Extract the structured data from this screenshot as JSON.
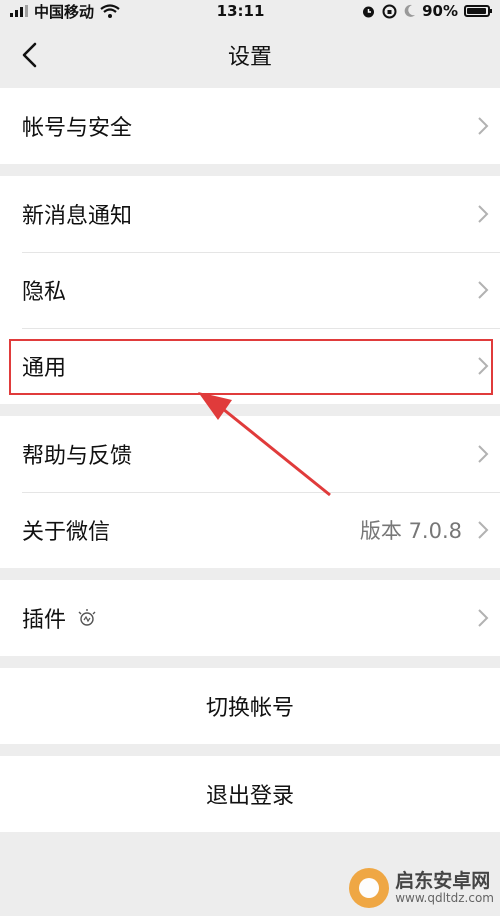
{
  "status_bar": {
    "carrier": "中国移动",
    "time": "13:11",
    "battery": "90%",
    "icons": [
      "signal-icon",
      "wifi-icon",
      "alarm-icon",
      "lock-rotation-icon",
      "moon-icon",
      "battery-icon"
    ]
  },
  "nav": {
    "title": "设置"
  },
  "groups": [
    {
      "items": [
        {
          "label": "帐号与安全"
        }
      ]
    },
    {
      "items": [
        {
          "label": "新消息通知"
        },
        {
          "label": "隐私"
        },
        {
          "label": "通用"
        }
      ]
    },
    {
      "items": [
        {
          "label": "帮助与反馈"
        },
        {
          "label": "关于微信",
          "value": "版本 7.0.8"
        }
      ]
    },
    {
      "items": [
        {
          "label": "插件"
        }
      ]
    }
  ],
  "actions": {
    "switch_account": "切换帐号",
    "logout": "退出登录"
  },
  "watermark": {
    "title": "启东安卓网",
    "url": "www.qdltdz.com"
  },
  "colors": {
    "highlight": "#e03b3b",
    "background": "#ededed"
  }
}
